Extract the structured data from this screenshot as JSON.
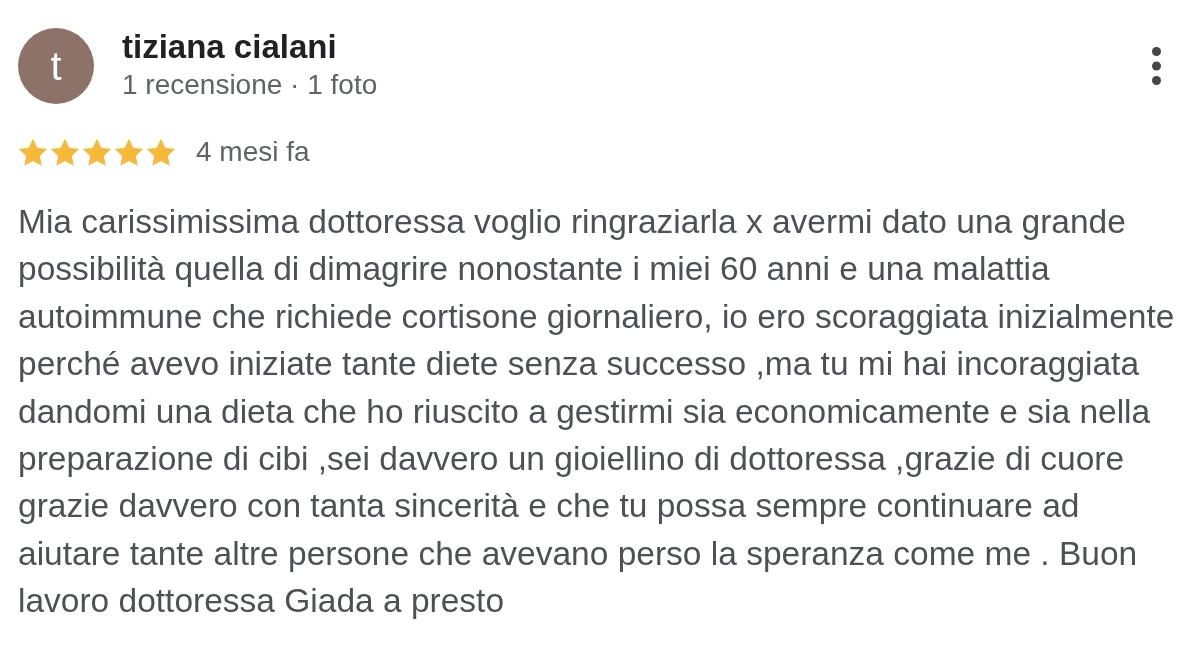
{
  "review": {
    "author": {
      "initial": "t",
      "name": "tiziana cialani",
      "meta": "1 recensione · 1 foto"
    },
    "stars": 5,
    "time": "4 mesi fa",
    "text": "Mia carissimissima dottoressa voglio ringraziarla x avermi dato una grande possibilità quella di dimagrire nonostante i miei 60 anni e una malattia autoimmune che richiede cortisone giornaliero, io ero scoraggiata inizialmente perché avevo iniziate tante diete senza successo ,ma tu mi hai incoraggiata dandomi una dieta che ho riuscito a gestirmi sia economicamente e sia nella preparazione di cibi ,sei davvero un gioiellino di dottoressa ,grazie di cuore grazie davvero con tanta sincerità e che tu possa sempre continuare ad aiutare tante altre persone che avevano perso la speranza come me . Buon lavoro dottoressa Giada a presto"
  }
}
